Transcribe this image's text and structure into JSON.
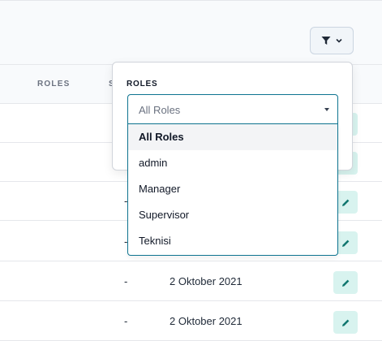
{
  "table": {
    "headers": {
      "roles": "ROLES",
      "status_partial": "S"
    },
    "rows": [
      {
        "roles": "",
        "status": "",
        "date": ""
      },
      {
        "roles": "",
        "status": "",
        "date": ""
      },
      {
        "roles": "",
        "status": "-",
        "date": ""
      },
      {
        "roles": "",
        "status": "-",
        "date": ""
      },
      {
        "roles": "",
        "status": "-",
        "date": "2 Oktober 2021"
      },
      {
        "roles": "",
        "status": "-",
        "date": "2 Oktober 2021"
      }
    ]
  },
  "filter": {
    "button_icon": "filter-icon",
    "dropdown_icon": "chevron-down-icon",
    "panel_label": "ROLES",
    "select": {
      "selected": "All Roles",
      "options": [
        "All Roles",
        "admin",
        "Manager",
        "Supervisor",
        "Teknisi"
      ]
    }
  },
  "colors": {
    "accent": "#0e7490",
    "edit_button_bg": "#d8f3ef",
    "edit_icon": "#0f766e"
  }
}
